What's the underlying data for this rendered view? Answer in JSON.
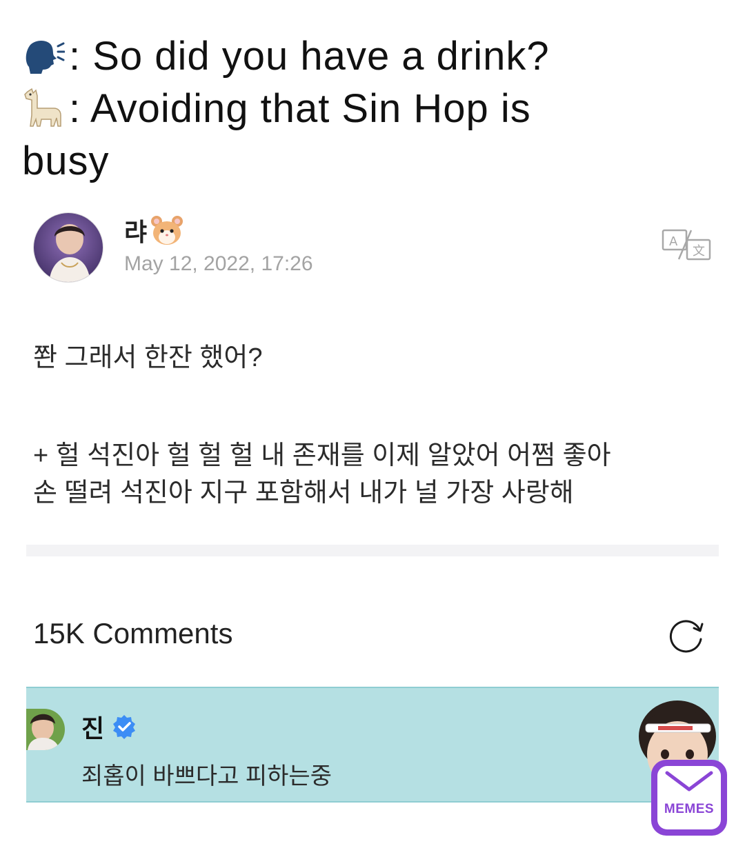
{
  "caption": {
    "line1_text": ": So did you have a drink?",
    "line2_text": ": Avoiding that Sin Hop is",
    "line3_text": "busy",
    "line1_icon": "speaking-head-icon",
    "line2_icon": "llama-icon"
  },
  "post": {
    "author_name": "랴",
    "author_icon": "hamster-icon",
    "timestamp": "May 12, 2022, 17:26",
    "body_line1": "쫜 그래서 한잔 했어?",
    "body_line2": "+ 헐 석진아 헐 헐 헐 내 존재를 이제 알았어 어쩜 좋아",
    "body_line3": "손 떨려 석진아 지구 포함해서 내가 널 가장 사랑해"
  },
  "comments": {
    "count_label": "15K Comments",
    "items": [
      {
        "author": "진",
        "badge": "verified-icon",
        "text": "죄홉이 바쁘다고 피하는중"
      }
    ]
  },
  "watermark": {
    "label": "MEMES"
  },
  "colors": {
    "comment_bg": "#b5e0e3",
    "verified_blue": "#3c8df5",
    "timestamp_gray": "#a3a3a3",
    "watermark_purple": "#8a45d6"
  }
}
